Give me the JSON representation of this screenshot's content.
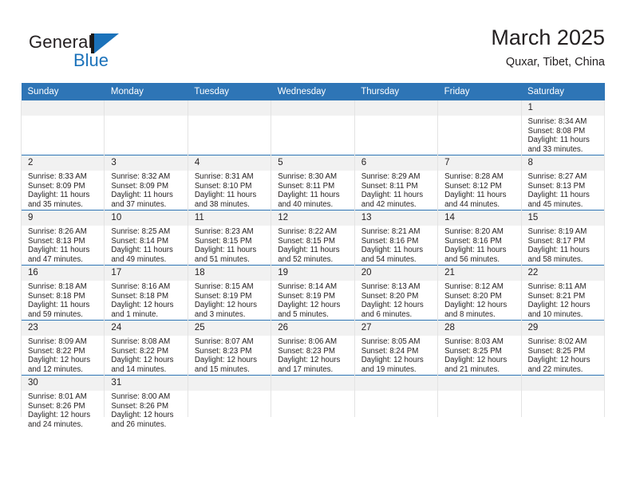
{
  "brand": {
    "name_part1": "General",
    "name_part2": "Blue",
    "logo_icon": "general-blue-flag-logo",
    "accent_color": "#1b72ba"
  },
  "header": {
    "title": "March 2025",
    "subtitle": "Quxar, Tibet, China"
  },
  "theme": {
    "header_blue": "#2e75b6",
    "daynum_gray": "#f1f1f1",
    "grid_line": "#e3e3e3",
    "text": "#231f20"
  },
  "weekdays": [
    "Sunday",
    "Monday",
    "Tuesday",
    "Wednesday",
    "Thursday",
    "Friday",
    "Saturday"
  ],
  "labels": {
    "sunrise_prefix": "Sunrise:",
    "sunset_prefix": "Sunset:",
    "daylight_prefix": "Daylight:"
  },
  "weeks": [
    [
      {
        "day": "",
        "empty": true
      },
      {
        "day": "",
        "empty": true
      },
      {
        "day": "",
        "empty": true
      },
      {
        "day": "",
        "empty": true
      },
      {
        "day": "",
        "empty": true
      },
      {
        "day": "",
        "empty": true
      },
      {
        "day": "1",
        "sunrise": "Sunrise: 8:34 AM",
        "sunset": "Sunset: 8:08 PM",
        "daylight": "Daylight: 11 hours and 33 minutes."
      }
    ],
    [
      {
        "day": "2",
        "sunrise": "Sunrise: 8:33 AM",
        "sunset": "Sunset: 8:09 PM",
        "daylight": "Daylight: 11 hours and 35 minutes."
      },
      {
        "day": "3",
        "sunrise": "Sunrise: 8:32 AM",
        "sunset": "Sunset: 8:09 PM",
        "daylight": "Daylight: 11 hours and 37 minutes."
      },
      {
        "day": "4",
        "sunrise": "Sunrise: 8:31 AM",
        "sunset": "Sunset: 8:10 PM",
        "daylight": "Daylight: 11 hours and 38 minutes."
      },
      {
        "day": "5",
        "sunrise": "Sunrise: 8:30 AM",
        "sunset": "Sunset: 8:11 PM",
        "daylight": "Daylight: 11 hours and 40 minutes."
      },
      {
        "day": "6",
        "sunrise": "Sunrise: 8:29 AM",
        "sunset": "Sunset: 8:11 PM",
        "daylight": "Daylight: 11 hours and 42 minutes."
      },
      {
        "day": "7",
        "sunrise": "Sunrise: 8:28 AM",
        "sunset": "Sunset: 8:12 PM",
        "daylight": "Daylight: 11 hours and 44 minutes."
      },
      {
        "day": "8",
        "sunrise": "Sunrise: 8:27 AM",
        "sunset": "Sunset: 8:13 PM",
        "daylight": "Daylight: 11 hours and 45 minutes."
      }
    ],
    [
      {
        "day": "9",
        "sunrise": "Sunrise: 8:26 AM",
        "sunset": "Sunset: 8:13 PM",
        "daylight": "Daylight: 11 hours and 47 minutes."
      },
      {
        "day": "10",
        "sunrise": "Sunrise: 8:25 AM",
        "sunset": "Sunset: 8:14 PM",
        "daylight": "Daylight: 11 hours and 49 minutes."
      },
      {
        "day": "11",
        "sunrise": "Sunrise: 8:23 AM",
        "sunset": "Sunset: 8:15 PM",
        "daylight": "Daylight: 11 hours and 51 minutes."
      },
      {
        "day": "12",
        "sunrise": "Sunrise: 8:22 AM",
        "sunset": "Sunset: 8:15 PM",
        "daylight": "Daylight: 11 hours and 52 minutes."
      },
      {
        "day": "13",
        "sunrise": "Sunrise: 8:21 AM",
        "sunset": "Sunset: 8:16 PM",
        "daylight": "Daylight: 11 hours and 54 minutes."
      },
      {
        "day": "14",
        "sunrise": "Sunrise: 8:20 AM",
        "sunset": "Sunset: 8:16 PM",
        "daylight": "Daylight: 11 hours and 56 minutes."
      },
      {
        "day": "15",
        "sunrise": "Sunrise: 8:19 AM",
        "sunset": "Sunset: 8:17 PM",
        "daylight": "Daylight: 11 hours and 58 minutes."
      }
    ],
    [
      {
        "day": "16",
        "sunrise": "Sunrise: 8:18 AM",
        "sunset": "Sunset: 8:18 PM",
        "daylight": "Daylight: 11 hours and 59 minutes."
      },
      {
        "day": "17",
        "sunrise": "Sunrise: 8:16 AM",
        "sunset": "Sunset: 8:18 PM",
        "daylight": "Daylight: 12 hours and 1 minute."
      },
      {
        "day": "18",
        "sunrise": "Sunrise: 8:15 AM",
        "sunset": "Sunset: 8:19 PM",
        "daylight": "Daylight: 12 hours and 3 minutes."
      },
      {
        "day": "19",
        "sunrise": "Sunrise: 8:14 AM",
        "sunset": "Sunset: 8:19 PM",
        "daylight": "Daylight: 12 hours and 5 minutes."
      },
      {
        "day": "20",
        "sunrise": "Sunrise: 8:13 AM",
        "sunset": "Sunset: 8:20 PM",
        "daylight": "Daylight: 12 hours and 6 minutes."
      },
      {
        "day": "21",
        "sunrise": "Sunrise: 8:12 AM",
        "sunset": "Sunset: 8:20 PM",
        "daylight": "Daylight: 12 hours and 8 minutes."
      },
      {
        "day": "22",
        "sunrise": "Sunrise: 8:11 AM",
        "sunset": "Sunset: 8:21 PM",
        "daylight": "Daylight: 12 hours and 10 minutes."
      }
    ],
    [
      {
        "day": "23",
        "sunrise": "Sunrise: 8:09 AM",
        "sunset": "Sunset: 8:22 PM",
        "daylight": "Daylight: 12 hours and 12 minutes."
      },
      {
        "day": "24",
        "sunrise": "Sunrise: 8:08 AM",
        "sunset": "Sunset: 8:22 PM",
        "daylight": "Daylight: 12 hours and 14 minutes."
      },
      {
        "day": "25",
        "sunrise": "Sunrise: 8:07 AM",
        "sunset": "Sunset: 8:23 PM",
        "daylight": "Daylight: 12 hours and 15 minutes."
      },
      {
        "day": "26",
        "sunrise": "Sunrise: 8:06 AM",
        "sunset": "Sunset: 8:23 PM",
        "daylight": "Daylight: 12 hours and 17 minutes."
      },
      {
        "day": "27",
        "sunrise": "Sunrise: 8:05 AM",
        "sunset": "Sunset: 8:24 PM",
        "daylight": "Daylight: 12 hours and 19 minutes."
      },
      {
        "day": "28",
        "sunrise": "Sunrise: 8:03 AM",
        "sunset": "Sunset: 8:25 PM",
        "daylight": "Daylight: 12 hours and 21 minutes."
      },
      {
        "day": "29",
        "sunrise": "Sunrise: 8:02 AM",
        "sunset": "Sunset: 8:25 PM",
        "daylight": "Daylight: 12 hours and 22 minutes."
      }
    ],
    [
      {
        "day": "30",
        "sunrise": "Sunrise: 8:01 AM",
        "sunset": "Sunset: 8:26 PM",
        "daylight": "Daylight: 12 hours and 24 minutes."
      },
      {
        "day": "31",
        "sunrise": "Sunrise: 8:00 AM",
        "sunset": "Sunset: 8:26 PM",
        "daylight": "Daylight: 12 hours and 26 minutes."
      },
      {
        "day": "",
        "empty": true
      },
      {
        "day": "",
        "empty": true
      },
      {
        "day": "",
        "empty": true
      },
      {
        "day": "",
        "empty": true
      },
      {
        "day": "",
        "empty": true
      }
    ]
  ]
}
